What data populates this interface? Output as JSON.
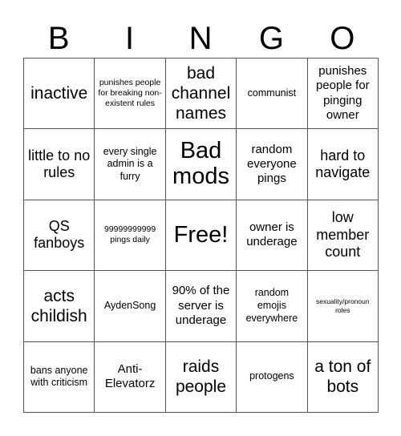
{
  "header": {
    "letters": [
      "B",
      "I",
      "N",
      "G",
      "O"
    ]
  },
  "card": {
    "cells": [
      {
        "text": "inactive",
        "size": "s-l"
      },
      {
        "text": "punishes people for breaking non-existent rules",
        "size": "s-xxs"
      },
      {
        "text": "bad channel names",
        "size": "s-l"
      },
      {
        "text": "communist",
        "size": "s-xs"
      },
      {
        "text": "punishes people for pinging owner",
        "size": "s-s"
      },
      {
        "text": "little to no rules",
        "size": "s-m"
      },
      {
        "text": "every single admin is a furry",
        "size": "s-xs"
      },
      {
        "text": "Bad mods",
        "size": "s-xl"
      },
      {
        "text": "random everyone pings",
        "size": "s-s"
      },
      {
        "text": "hard to navigate",
        "size": "s-m"
      },
      {
        "text": "QS fanboys",
        "size": "s-m"
      },
      {
        "text": "99999999999 pings daily",
        "size": "s-xxs"
      },
      {
        "text": "Free!",
        "size": "s-xl"
      },
      {
        "text": "owner is underage",
        "size": "s-s"
      },
      {
        "text": "low member count",
        "size": "s-m"
      },
      {
        "text": "acts childish",
        "size": "s-l"
      },
      {
        "text": "AydenSong",
        "size": "s-xs"
      },
      {
        "text": "90% of the server is underage",
        "size": "s-s"
      },
      {
        "text": "random emojis everywhere",
        "size": "s-xs"
      },
      {
        "text": "sexuality/pronoun roles",
        "size": "s-tiny"
      },
      {
        "text": "bans anyone with criticism",
        "size": "s-xs"
      },
      {
        "text": "Anti-Elevatorz",
        "size": "s-s"
      },
      {
        "text": "raids people",
        "size": "s-l"
      },
      {
        "text": "protogens",
        "size": "s-xs"
      },
      {
        "text": "a ton of bots",
        "size": "s-l"
      }
    ]
  }
}
